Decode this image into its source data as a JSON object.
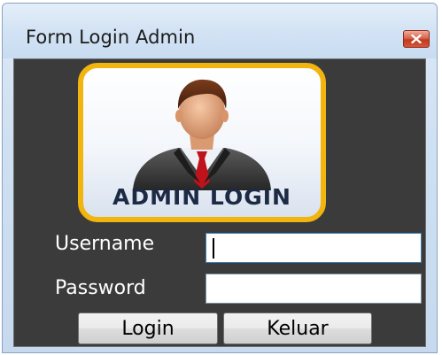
{
  "window": {
    "title": "Form Login Admin",
    "close_icon": "close-icon"
  },
  "logo": {
    "icon": "admin-user-icon",
    "caption": "ADMIN LOGIN",
    "border_color": "#f2b40f",
    "tie_color": "#c0121b"
  },
  "form": {
    "username_label": "Username",
    "username_value": "",
    "password_label": "Password",
    "password_value": ""
  },
  "buttons": {
    "login_label": "Login",
    "exit_label": "Keluar"
  },
  "colors": {
    "client_background": "#3b3b3b",
    "label_text": "#ffffff"
  }
}
